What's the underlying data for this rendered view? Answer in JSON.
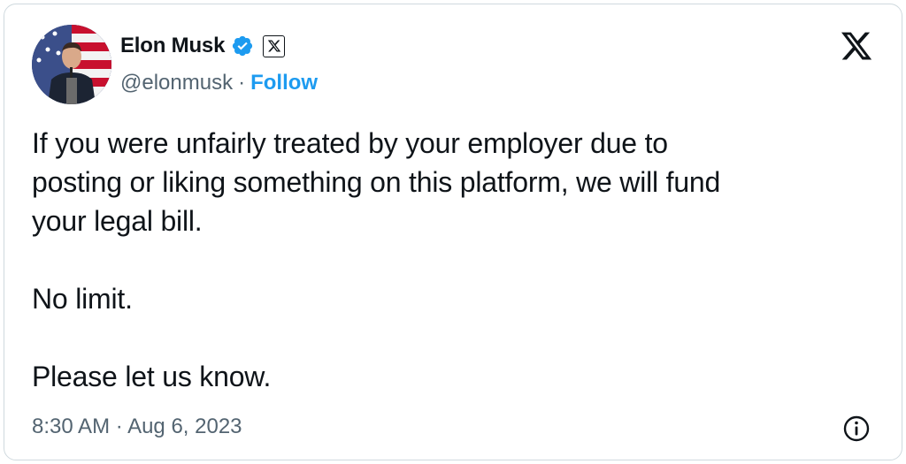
{
  "author": {
    "name": "Elon Musk",
    "handle": "@elonmusk",
    "follow_label": "Follow",
    "separator": "·"
  },
  "icons": {
    "verified": "verified-badge-icon",
    "affiliation": "x-affiliation-badge-icon",
    "platform": "x-logo-icon",
    "info": "info-icon"
  },
  "tweet": {
    "lines": [
      "If you were unfairly treated by your employer due to",
      "posting or liking something on this platform, we will fund",
      "your legal bill."
    ],
    "line2": "No limit.",
    "line3": "Please let us know.",
    "time": "8:30 AM",
    "separator": "·",
    "date": "Aug 6, 2023"
  },
  "colors": {
    "accent": "#1d9bf0",
    "text": "#0f1419",
    "secondary": "#536471",
    "border": "#cfd9de"
  }
}
